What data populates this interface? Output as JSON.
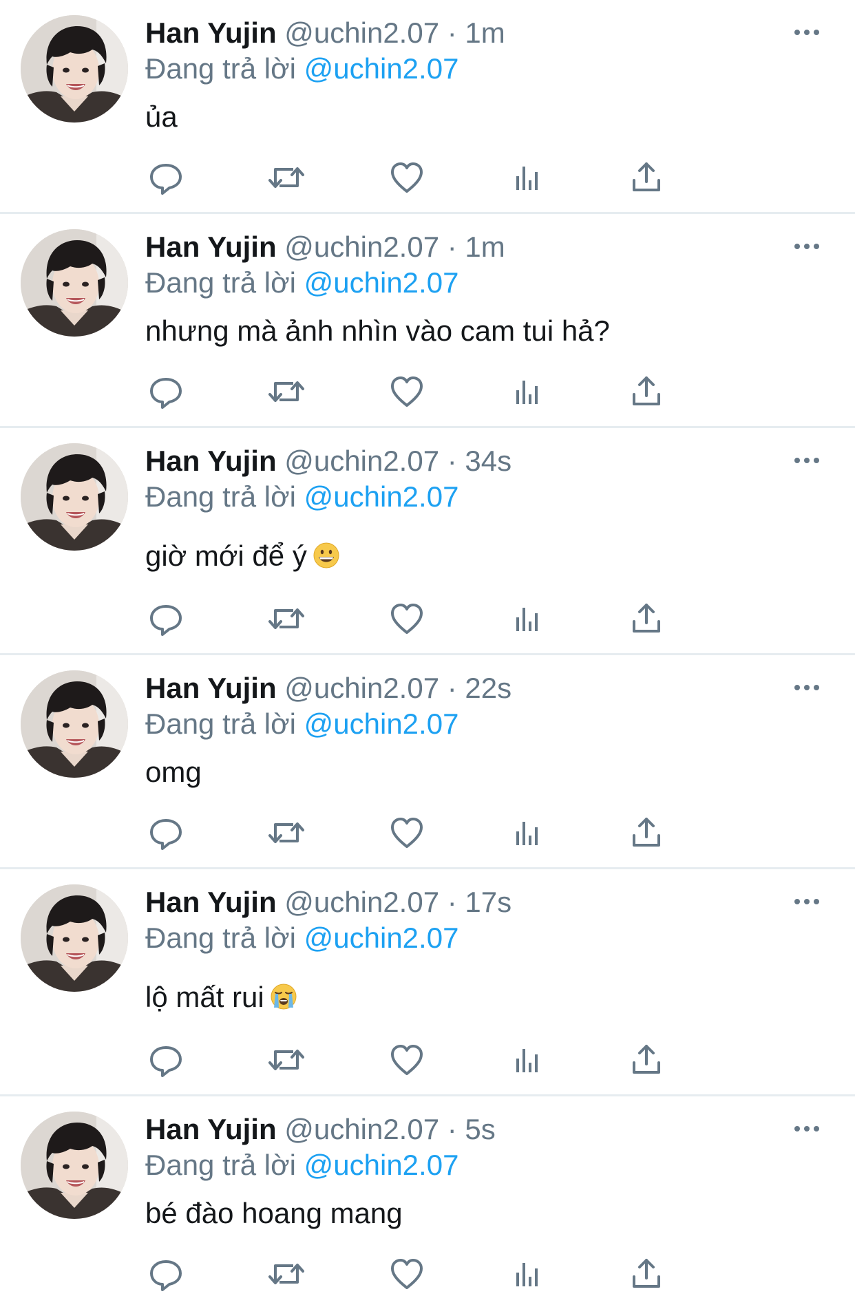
{
  "tweets": [
    {
      "name": "Han Yujin",
      "handle": "@uchin2.07",
      "sep": "·",
      "time": "1m",
      "reply_prefix": "Đang trả lời",
      "reply_handle": "@uchin2.07",
      "text": "ủa",
      "emoji": ""
    },
    {
      "name": "Han Yujin",
      "handle": "@uchin2.07",
      "sep": "·",
      "time": "1m",
      "reply_prefix": "Đang trả lời",
      "reply_handle": "@uchin2.07",
      "text": "nhưng mà ảnh nhìn vào cam tui hả?",
      "emoji": ""
    },
    {
      "name": "Han Yujin",
      "handle": "@uchin2.07",
      "sep": "·",
      "time": "34s",
      "reply_prefix": "Đang trả lời",
      "reply_handle": "@uchin2.07",
      "text": "giờ mới để ý",
      "emoji": "grinning-face"
    },
    {
      "name": "Han Yujin",
      "handle": "@uchin2.07",
      "sep": "·",
      "time": "22s",
      "reply_prefix": "Đang trả lời",
      "reply_handle": "@uchin2.07",
      "text": "omg",
      "emoji": ""
    },
    {
      "name": "Han Yujin",
      "handle": "@uchin2.07",
      "sep": "·",
      "time": "17s",
      "reply_prefix": "Đang trả lời",
      "reply_handle": "@uchin2.07",
      "text": "lộ mất rui",
      "emoji": "loudly-crying-face"
    },
    {
      "name": "Han Yujin",
      "handle": "@uchin2.07",
      "sep": "·",
      "time": "5s",
      "reply_prefix": "Đang trả lời",
      "reply_handle": "@uchin2.07",
      "text": "bé đào hoang mang",
      "emoji": ""
    }
  ],
  "action_icons": [
    "reply-icon",
    "retweet-icon",
    "like-icon",
    "analytics-icon",
    "share-icon"
  ],
  "colors": {
    "name": "#14171a",
    "secondary": "#657786",
    "link": "#1da1f2",
    "icon": "#657786",
    "divider": "#e6ecf0"
  }
}
